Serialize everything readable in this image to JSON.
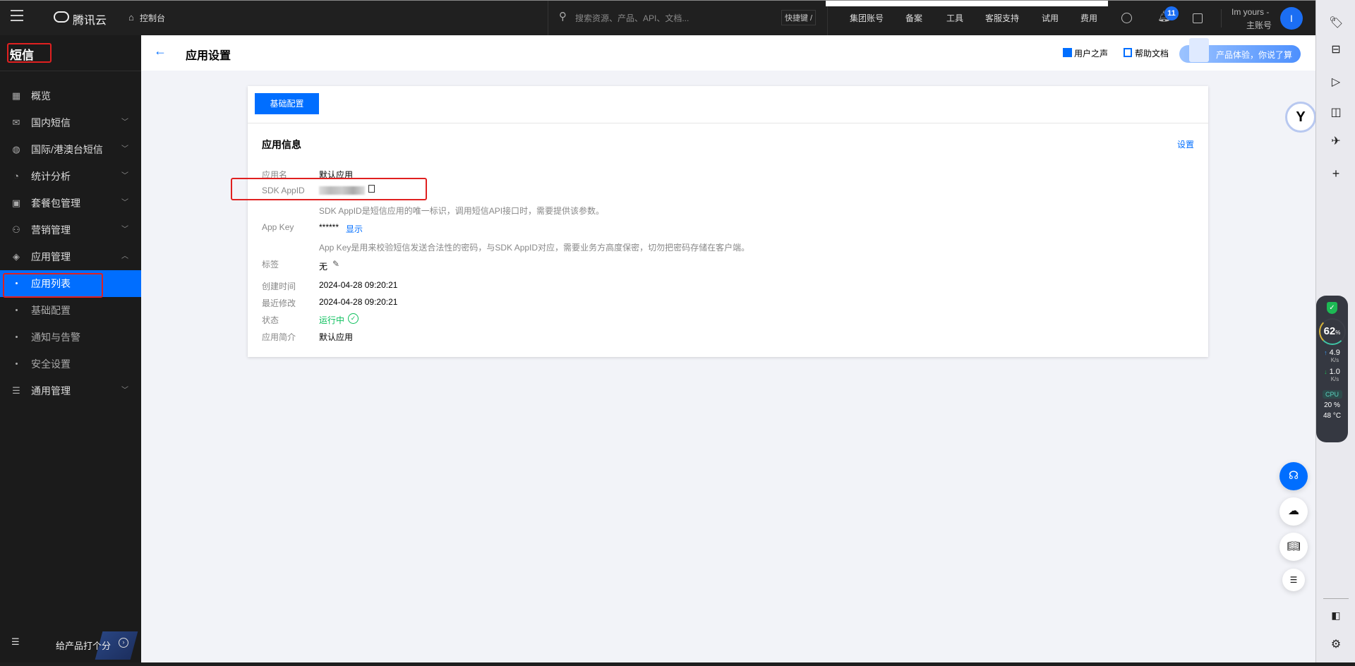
{
  "topbar": {
    "brand": "腾讯云",
    "console": "控制台",
    "search_placeholder": "搜索资源、产品、API、文档...",
    "shortcut": "快捷键 /",
    "nav": [
      "集团账号",
      "备案",
      "工具",
      "客服支持",
      "试用",
      "费用"
    ],
    "notification_count": "11",
    "user_name": "Im yours -",
    "user_role": "主账号",
    "avatar_initial": "I"
  },
  "sidebar": {
    "title": "短信",
    "items": [
      {
        "label": "概览",
        "icon": "grid-icon",
        "chevron": false
      },
      {
        "label": "国内短信",
        "icon": "mail-icon",
        "chevron": true
      },
      {
        "label": "国际/港澳台短信",
        "icon": "globe-icon",
        "chevron": true
      },
      {
        "label": "统计分析",
        "icon": "pie-chart-icon",
        "chevron": true
      },
      {
        "label": "套餐包管理",
        "icon": "package-icon",
        "chevron": true
      },
      {
        "label": "营销管理",
        "icon": "users-icon",
        "chevron": true
      },
      {
        "label": "应用管理",
        "icon": "layers-icon",
        "chevron": true,
        "expanded": true
      }
    ],
    "subitems": [
      "应用列表",
      "基础配置",
      "通知与告警",
      "安全设置"
    ],
    "active_subitem": "应用列表",
    "last_item": {
      "label": "通用管理",
      "icon": "sliders-icon"
    },
    "rate_label": "给产品打个分"
  },
  "header": {
    "title": "应用设置",
    "user_voice": "用户之声",
    "help_docs": "帮助文档",
    "promo": "产品体验，你说了算"
  },
  "card": {
    "tab": "基础配置",
    "section_title": "应用信息",
    "settings_link": "设置",
    "rows": {
      "app_name_label": "应用名",
      "app_name": "默认应用",
      "sdk_label": "SDK AppID",
      "sdk_hint": "SDK AppID是短信应用的唯一标识，调用短信API接口时，需要提供该参数。",
      "appkey_label": "App Key",
      "appkey_value": "******",
      "appkey_show": "显示",
      "appkey_hint": "App Key是用来校验短信发送合法性的密码，与SDK AppID对应，需要业务方高度保密，切勿把密码存储在客户端。",
      "tag_label": "标签",
      "tag_value": "无",
      "created_label": "创建时间",
      "created": "2024-04-28 09:20:21",
      "modified_label": "最近修改",
      "modified": "2024-04-28 09:20:21",
      "status_label": "状态",
      "status": "运行中",
      "desc_label": "应用简介",
      "desc": "默认应用"
    }
  },
  "widget": {
    "percent": "62",
    "pct_sign": "%",
    "up": "4.9",
    "down": "1.0",
    "unit": "K/s",
    "cpu_label": "CPU",
    "cpu": "20 %",
    "temp": "48 °C"
  },
  "colors": {
    "accent": "#006eff",
    "success": "#0abf5b",
    "highlight": "#e02020"
  }
}
